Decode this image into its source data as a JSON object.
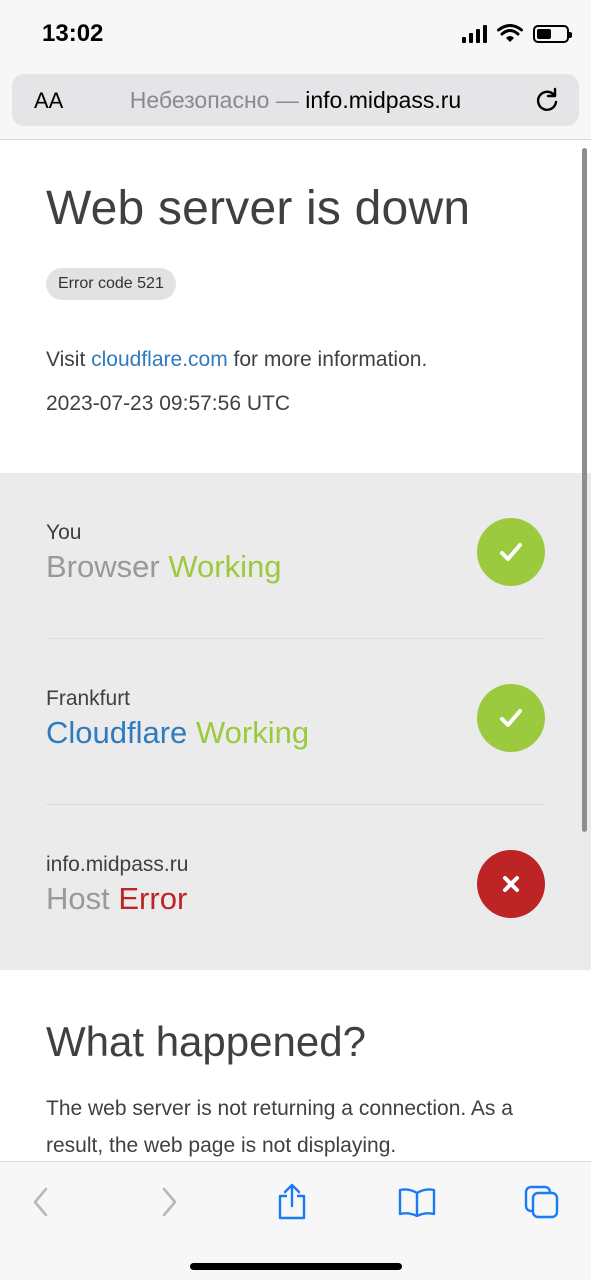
{
  "status_bar": {
    "time": "13:02"
  },
  "browser": {
    "text_size_label": "AA",
    "url_prefix": "Небезопасно — ",
    "url_host": "info.midpass.ru"
  },
  "page": {
    "title": "Web server is down",
    "error_badge": "Error code 521",
    "visit_prefix": "Visit ",
    "visit_link": "cloudflare.com",
    "visit_suffix": " for more information.",
    "timestamp": "2023-07-23 09:57:56 UTC",
    "rows": [
      {
        "label": "You",
        "name": "Browser",
        "status": "Working"
      },
      {
        "label": "Frankfurt",
        "name": "Cloudflare",
        "status": "Working"
      },
      {
        "label": "info.midpass.ru",
        "name": "Host",
        "status": "Error"
      }
    ],
    "what_happened_title": "What happened?",
    "what_happened_text": "The web server is not returning a connection. As a result, the web page is not displaying."
  },
  "colors": {
    "ok": "#9bca3e",
    "error": "#bd2426",
    "link": "#2f7bbf"
  }
}
